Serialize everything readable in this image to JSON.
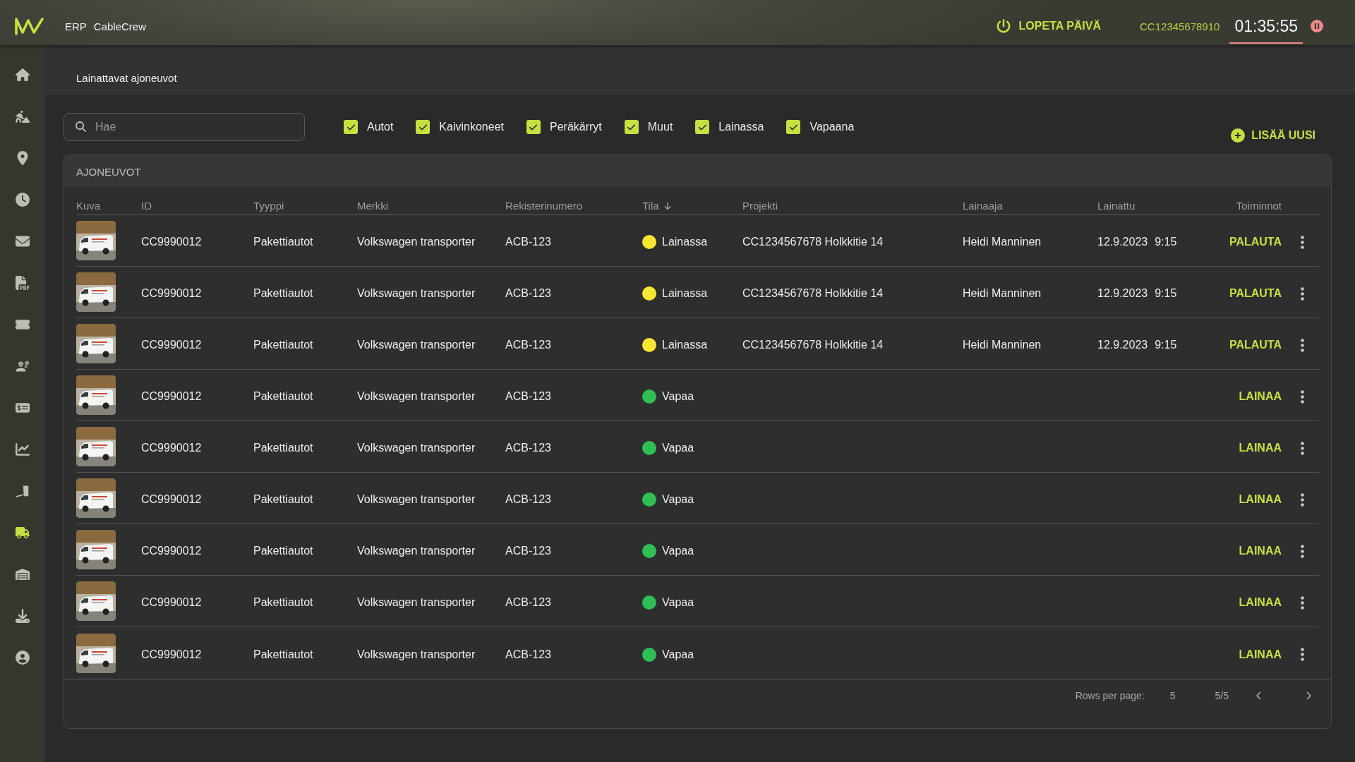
{
  "header": {
    "app": "ERP",
    "company": "CableCrew",
    "end_day": "LOPETA PÄIVÄ",
    "user_id": "CC12345678910",
    "timer": "01:35:55"
  },
  "sidebar": {
    "items": [
      {
        "selected": false
      },
      {
        "selected": false
      },
      {
        "selected": false
      },
      {
        "selected": false
      },
      {
        "selected": false
      },
      {
        "selected": false
      },
      {
        "selected": false
      },
      {
        "selected": false
      },
      {
        "selected": false
      },
      {
        "selected": false
      },
      {
        "selected": false
      },
      {
        "selected": true
      },
      {
        "selected": false
      },
      {
        "selected": false
      },
      {
        "selected": false
      }
    ]
  },
  "page": {
    "title": "Lainattavat ajoneuvot"
  },
  "search": {
    "placeholder": "Hae"
  },
  "filters": [
    {
      "label": "Autot",
      "checked": true
    },
    {
      "label": "Kaivinkoneet",
      "checked": true
    },
    {
      "label": "Peräkärryt",
      "checked": true
    },
    {
      "label": "Muut",
      "checked": true
    },
    {
      "label": "Lainassa",
      "checked": true
    },
    {
      "label": "Vapaana",
      "checked": true
    }
  ],
  "add_button": "LISÄÄ UUSI",
  "table": {
    "title": "AJONEUVOT",
    "columns": [
      {
        "label": "Kuva",
        "sorted": false
      },
      {
        "label": "ID",
        "sorted": false
      },
      {
        "label": "Tyyppi",
        "sorted": false
      },
      {
        "label": "Merkki",
        "sorted": false
      },
      {
        "label": "Rekisterinumero",
        "sorted": false
      },
      {
        "label": "Tila",
        "sorted": true
      },
      {
        "label": "Projekti",
        "sorted": false
      },
      {
        "label": "Lainaaja",
        "sorted": false
      },
      {
        "label": "Lainattu",
        "sorted": false
      },
      {
        "label": "Toiminnot",
        "sorted": false
      }
    ],
    "rows": [
      {
        "id": "CC9990012",
        "type": "Pakettiautot",
        "brand": "Volkswagen transporter",
        "plate": "ACB-123",
        "status": "Lainassa",
        "color": "#f7e733",
        "project": "CC1234567678 Holkkitie 14",
        "borrower": "Heidi Manninen",
        "date": "12.9.2023",
        "time": "9:15",
        "action": "PALAUTA"
      },
      {
        "id": "CC9990012",
        "type": "Pakettiautot",
        "brand": "Volkswagen transporter",
        "plate": "ACB-123",
        "status": "Lainassa",
        "color": "#f7e733",
        "project": "CC1234567678 Holkkitie 14",
        "borrower": "Heidi Manninen",
        "date": "12.9.2023",
        "time": "9:15",
        "action": "PALAUTA"
      },
      {
        "id": "CC9990012",
        "type": "Pakettiautot",
        "brand": "Volkswagen transporter",
        "plate": "ACB-123",
        "status": "Lainassa",
        "color": "#f7e733",
        "project": "CC1234567678 Holkkitie 14",
        "borrower": "Heidi Manninen",
        "date": "12.9.2023",
        "time": "9:15",
        "action": "PALAUTA"
      },
      {
        "id": "CC9990012",
        "type": "Pakettiautot",
        "brand": "Volkswagen transporter",
        "plate": "ACB-123",
        "status": "Vapaa",
        "color": "#2fbf55",
        "action": "LAINAA"
      },
      {
        "id": "CC9990012",
        "type": "Pakettiautot",
        "brand": "Volkswagen transporter",
        "plate": "ACB-123",
        "status": "Vapaa",
        "color": "#2fbf55",
        "action": "LAINAA"
      },
      {
        "id": "CC9990012",
        "type": "Pakettiautot",
        "brand": "Volkswagen transporter",
        "plate": "ACB-123",
        "status": "Vapaa",
        "color": "#2fbf55",
        "action": "LAINAA"
      },
      {
        "id": "CC9990012",
        "type": "Pakettiautot",
        "brand": "Volkswagen transporter",
        "plate": "ACB-123",
        "status": "Vapaa",
        "color": "#2fbf55",
        "action": "LAINAA"
      },
      {
        "id": "CC9990012",
        "type": "Pakettiautot",
        "brand": "Volkswagen transporter",
        "plate": "ACB-123",
        "status": "Vapaa",
        "color": "#2fbf55",
        "action": "LAINAA"
      },
      {
        "id": "CC9990012",
        "type": "Pakettiautot",
        "brand": "Volkswagen transporter",
        "plate": "ACB-123",
        "status": "Vapaa",
        "color": "#2fbf55",
        "action": "LAINAA"
      }
    ]
  },
  "pagination": {
    "label": "Rows per page:",
    "rows_per_page": "5",
    "page": "5/5"
  }
}
